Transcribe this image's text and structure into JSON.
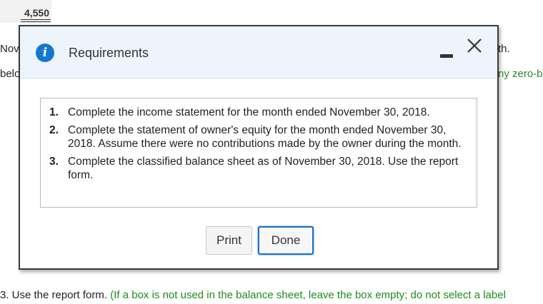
{
  "background": {
    "total_value": "4,550",
    "left_line1": "Nov",
    "left_line2": "belo",
    "right_line1": "th.",
    "right_line2": "ny zero-b",
    "bottom_prefix": "3. Use the report form.",
    "bottom_hint": "(If a box is not used in the balance sheet, leave the box empty; do not select a label"
  },
  "dialog": {
    "title": "Requirements",
    "info_icon": "info-icon",
    "minimize_icon": "minimize-icon",
    "close_icon": "close-icon",
    "requirements": [
      {
        "number": "1.",
        "text": "Complete the income statement for the month ended November 30, 2018."
      },
      {
        "number": "2.",
        "text": "Complete the statement of owner's equity for the month ended November 30, 2018. Assume there were no contributions made by the owner during the month."
      },
      {
        "number": "3.",
        "text": "Complete the classified balance sheet as of November 30, 2018. Use the report form."
      }
    ],
    "buttons": {
      "print_label": "Print",
      "done_label": "Done"
    }
  },
  "colors": {
    "accent": "#1577cf",
    "header_bg": "#eef4fb",
    "hint_green": "#1f8a1f",
    "done_border": "#1d72c9"
  }
}
